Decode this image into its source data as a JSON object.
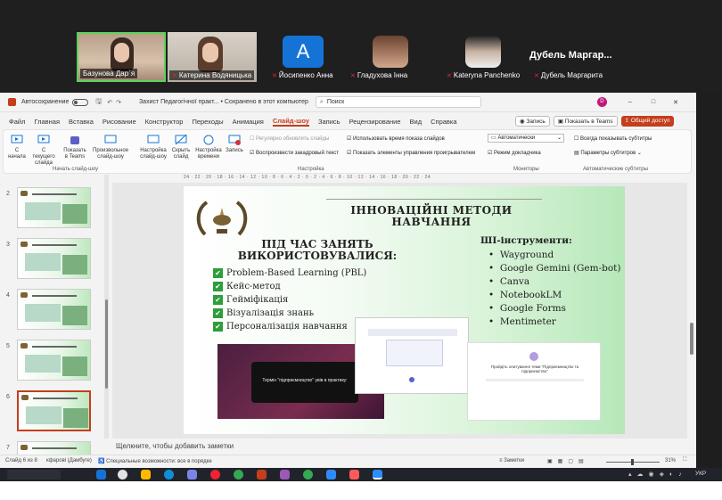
{
  "participants": [
    {
      "name": "Базунова Дар`я",
      "mic_muted": false
    },
    {
      "name": "Катерина Водяницька",
      "mic_muted": true
    },
    {
      "name": "Йосипенко Анна",
      "mic_muted": true,
      "initial": "A"
    },
    {
      "name": "Гладухова Інна",
      "mic_muted": true
    },
    {
      "name": "Kateryna Panchenko",
      "mic_muted": true
    },
    {
      "name": "Дубель Маргарита",
      "mic_muted": true,
      "header": "Дубель Маргар..."
    }
  ],
  "titlebar": {
    "autosave": "Автосохранение",
    "doc_title": "Захист Педагогічної практ... • Сохранено в этот компьютер",
    "search_placeholder": "Поиск",
    "avatar": "D"
  },
  "tabs": [
    "Файл",
    "Главная",
    "Вставка",
    "Рисование",
    "Конструктор",
    "Переходы",
    "Анимация",
    "Слайд-шоу",
    "Запись",
    "Рецензирование",
    "Вид",
    "Справка"
  ],
  "actions": {
    "record": "Запись",
    "teams": "Показать в Teams",
    "share": "Общий доступ"
  },
  "ribbon": {
    "b1": "С начала",
    "b2": "С текущего слайда",
    "b3": "Показать в Teams",
    "b4": "Произвольное слайд-шоу",
    "b5": "Настройка слайд-шоу",
    "b6": "Скрыть слайд",
    "b7": "Настройка времени",
    "b8": "Запись",
    "opt1": "Регулярно обновлять слайды",
    "opt2": "Воспроизвести закадровый текст",
    "opt3": "Использовать время показа слайдов",
    "opt4": "Показать элементы управления проигрывателем",
    "mon": "Автоматически",
    "mon2": "Режим докладчика",
    "sub1": "Всегда показывать субтитры",
    "sub2": "Параметры субтитров",
    "g1": "Начать слайд-шоу",
    "g2": "Настройка",
    "g3": "Мониторы",
    "g4": "Автоматические субтитры"
  },
  "thumbs": [
    "2",
    "3",
    "4",
    "5",
    "6",
    "7"
  ],
  "ruler": "24 · 22 · 20 · 18 · 16 · 14 · 12 · 10 · 8 · 6 · 4 · 2 · 0 · 2 · 4 · 6 · 8 · 10 · 12 · 14 · 16 · 18 · 20 · 22 · 24",
  "slide": {
    "title1": "ІННОВАЦІЙНІ МЕТОДИ",
    "title2": "НАВЧАННЯ",
    "sub1": "ПІД ЧАС ЗАНЯТЬ",
    "sub2": "ВИКОРИСТОВУВАЛИСЯ:",
    "methods": [
      "Problem-Based Learning (PBL)",
      "Кейс-метод",
      "Гейміфікація",
      "Візуалізація знань",
      "Персоналізація навчання"
    ],
    "tools_title": "ШІ-інструменти:",
    "tools": [
      "Wayground",
      "Google Gemini (Gem-bot)",
      "Canva",
      "NotebookLM",
      "Google Forms",
      "Mentimeter"
    ],
    "shot1_text": "Термін \"підприємництво\" увів в практику:",
    "shot3_text": "Пройдіть опитування теми \"Підприємництво та підприємство\""
  },
  "notes": "Щелкните, чтобы добавить заметки",
  "status": {
    "slide": "Слайд 6 из 8",
    "user": "кфарові (Дамбуге)",
    "access": "Специальные возможности: все в порядке",
    "notes": "Заметки",
    "zoom": "31%"
  },
  "bottom": {
    "lang": "УКР"
  }
}
